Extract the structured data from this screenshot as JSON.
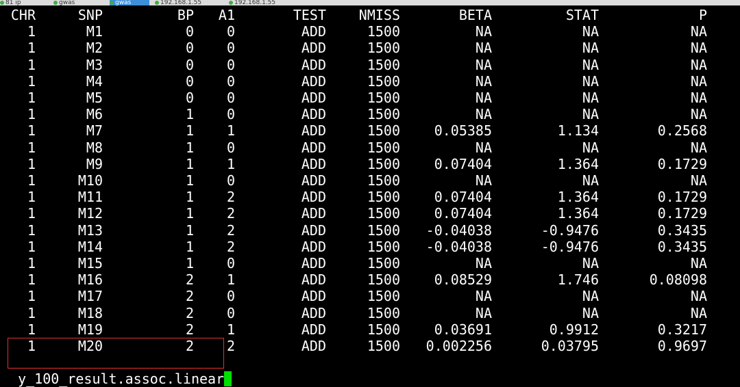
{
  "tabs": [
    {
      "label": "81 ip",
      "active": false
    },
    {
      "label": "gwas",
      "active": false
    },
    {
      "label": "gwas",
      "active": true
    },
    {
      "label": "192.168.1.55",
      "active": false
    },
    {
      "label": "192.168.1.55",
      "active": false
    }
  ],
  "table": {
    "columns": [
      "CHR",
      "SNP",
      "BP",
      "A1",
      "TEST",
      "NMISS",
      "BETA",
      "STAT",
      "P"
    ],
    "rows": [
      [
        "1",
        "M1",
        "0",
        "0",
        "ADD",
        "1500",
        "NA",
        "NA",
        "NA"
      ],
      [
        "1",
        "M2",
        "0",
        "0",
        "ADD",
        "1500",
        "NA",
        "NA",
        "NA"
      ],
      [
        "1",
        "M3",
        "0",
        "0",
        "ADD",
        "1500",
        "NA",
        "NA",
        "NA"
      ],
      [
        "1",
        "M4",
        "0",
        "0",
        "ADD",
        "1500",
        "NA",
        "NA",
        "NA"
      ],
      [
        "1",
        "M5",
        "0",
        "0",
        "ADD",
        "1500",
        "NA",
        "NA",
        "NA"
      ],
      [
        "1",
        "M6",
        "1",
        "0",
        "ADD",
        "1500",
        "NA",
        "NA",
        "NA"
      ],
      [
        "1",
        "M7",
        "1",
        "1",
        "ADD",
        "1500",
        "0.05385",
        "1.134",
        "0.2568"
      ],
      [
        "1",
        "M8",
        "1",
        "0",
        "ADD",
        "1500",
        "NA",
        "NA",
        "NA"
      ],
      [
        "1",
        "M9",
        "1",
        "1",
        "ADD",
        "1500",
        "0.07404",
        "1.364",
        "0.1729"
      ],
      [
        "1",
        "M10",
        "1",
        "0",
        "ADD",
        "1500",
        "NA",
        "NA",
        "NA"
      ],
      [
        "1",
        "M11",
        "1",
        "2",
        "ADD",
        "1500",
        "0.07404",
        "1.364",
        "0.1729"
      ],
      [
        "1",
        "M12",
        "1",
        "2",
        "ADD",
        "1500",
        "0.07404",
        "1.364",
        "0.1729"
      ],
      [
        "1",
        "M13",
        "1",
        "2",
        "ADD",
        "1500",
        "-0.04038",
        "-0.9476",
        "0.3435"
      ],
      [
        "1",
        "M14",
        "1",
        "2",
        "ADD",
        "1500",
        "-0.04038",
        "-0.9476",
        "0.3435"
      ],
      [
        "1",
        "M15",
        "1",
        "0",
        "ADD",
        "1500",
        "NA",
        "NA",
        "NA"
      ],
      [
        "1",
        "M16",
        "2",
        "1",
        "ADD",
        "1500",
        "0.08529",
        "1.746",
        "0.08098"
      ],
      [
        "1",
        "M17",
        "2",
        "0",
        "ADD",
        "1500",
        "NA",
        "NA",
        "NA"
      ],
      [
        "1",
        "M18",
        "2",
        "0",
        "ADD",
        "1500",
        "NA",
        "NA",
        "NA"
      ],
      [
        "1",
        "M19",
        "2",
        "1",
        "ADD",
        "1500",
        "0.03691",
        "0.9912",
        "0.3217"
      ],
      [
        "1",
        "M20",
        "2",
        "2",
        "ADD",
        "1500",
        "0.002256",
        "0.03795",
        "0.9697"
      ]
    ]
  },
  "prompt": {
    "text": "y_100_result.assoc.linear"
  },
  "colors": {
    "background": "#000000",
    "foreground": "#ffffff",
    "cursor": "#00e000",
    "highlight_border": "#e53030",
    "active_tab": "#3d8fd8"
  }
}
